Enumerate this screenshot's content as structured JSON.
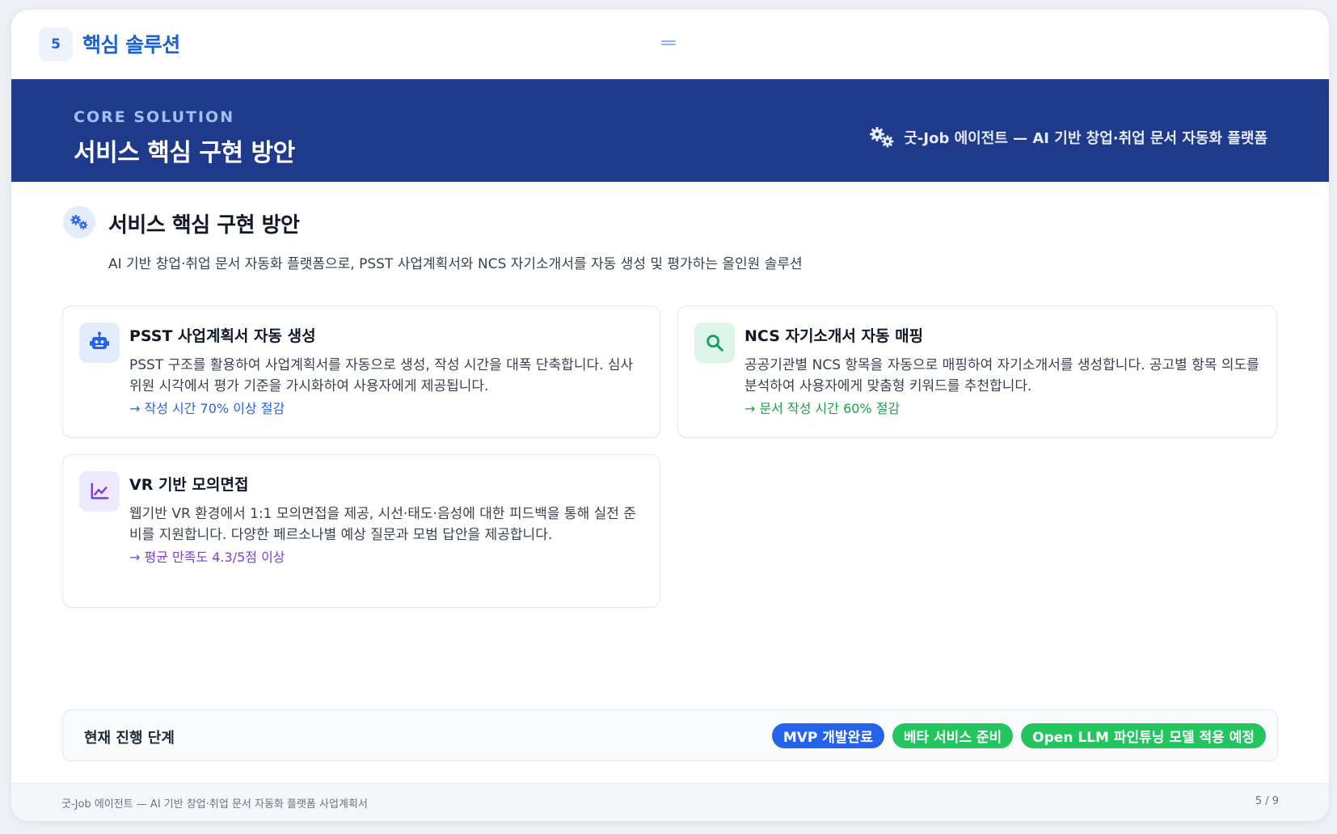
{
  "topbar": {
    "page_number": "5",
    "section_title": "핵심 솔루션"
  },
  "banner": {
    "eyebrow": "CORE SOLUTION",
    "title": "서비스 핵심 구현 방안",
    "product_line": "굿-Job 에이전트 — AI 기반 창업·취업 문서 자동화 플랫폼"
  },
  "section": {
    "heading": "서비스 핵심 구현 방안",
    "description": "AI 기반 창업·취업 문서 자동화 플랫폼으로, PSST 사업계획서와 NCS 자기소개서를 자동 생성 및 평가하는 올인원 솔루션"
  },
  "cards": [
    {
      "icon": "robot-icon",
      "title": "PSST 사업계획서 자동 생성",
      "body": "PSST 구조를 활용하여 사업계획서를 자동으로 생성, 작성 시간을 대폭 단축합니다. 심사위원 시각에서 평가 기준을 가시화하여 사용자에게 제공됩니다.",
      "metric": "→ 작성 시간 70% 이상 절감",
      "accent": "#2563eb",
      "icon_bg": "#e3ecfb"
    },
    {
      "icon": "search-icon",
      "title": "NCS 자기소개서 자동 매핑",
      "body": "공공기관별 NCS 항목을 자동으로 매핑하여 자기소개서를 생성합니다. 공고별 항목 의도를 분석하여 사용자에게 맞춤형 키워드를 추천합니다.",
      "metric": "→ 문서 작성 시간 60% 절감",
      "accent": "#16a34a",
      "icon_bg": "#dcf5e8"
    },
    {
      "icon": "chart-line-icon",
      "title": "VR 기반 모의면접",
      "body": "웹기반 VR 환경에서 1:1 모의면접을 제공, 시선·태도·음성에 대한 피드백을 통해 실전 준비를 지원합니다. 다양한 페르소나별 예상 질문과 모범 답안을 제공합니다.",
      "metric": "→ 평균 만족도 4.3/5점 이상",
      "accent": "#7c3aed",
      "icon_bg": "#efe9fd"
    }
  ],
  "progress": {
    "label": "현재 진행 단계",
    "pills": [
      {
        "label": "MVP 개발완료",
        "color": "#2563eb"
      },
      {
        "label": "베타 서비스 준비",
        "color": "#22c55e"
      },
      {
        "label": "Open LLM 파인튜닝 모델 적용 예정",
        "color": "#22c55e"
      }
    ]
  },
  "footer": {
    "left": "굿-Job 에이전트 — AI 기반 창업·취업 문서 자동화 플랫폼 사업계획서",
    "right": "5 / 9"
  }
}
